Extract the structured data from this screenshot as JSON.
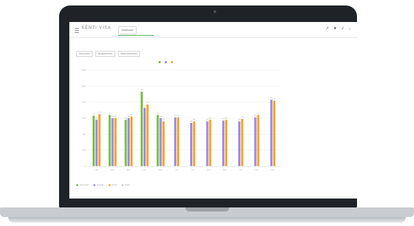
{
  "app": {
    "title": "KENTI VISA",
    "tab_label": "Dashboard",
    "header_icons": [
      "↗",
      "▼",
      "✓",
      "↓"
    ]
  },
  "filters": [
    "Time period",
    "All departments",
    "Select parameters"
  ],
  "colors": {
    "green": "#7bc043",
    "purple": "#9b8be6",
    "orange": "#f5a623"
  },
  "chart_data": {
    "type": "bar",
    "categories": [
      "Jan",
      "Feb",
      "Mar",
      "Apr",
      "May",
      "Jun",
      "Jul",
      "Aug",
      "Sep",
      "Oct",
      "Nov",
      "Dec"
    ],
    "ylim": [
      0,
      1200
    ],
    "yticks": [
      0,
      200,
      400,
      600,
      800,
      1000,
      1200
    ],
    "series": [
      {
        "name": "",
        "color": "#7bc043",
        "values": [
          630,
          640,
          580,
          930,
          640,
          null,
          null,
          null,
          null,
          null,
          null,
          null
        ]
      },
      {
        "name": "",
        "color": "#9b8be6",
        "values": [
          580,
          600,
          600,
          730,
          600,
          610,
          540,
          560,
          570,
          560,
          610,
          830
        ]
      },
      {
        "name": "",
        "color": "#f5a623",
        "values": [
          650,
          600,
          620,
          770,
          560,
          610,
          560,
          580,
          580,
          590,
          640,
          820
        ]
      }
    ],
    "legend_placement": "top-center",
    "grid": true
  },
  "footer": {
    "items": [
      {
        "color": "#7bc043",
        "label": "Last period"
      },
      {
        "color": "#9b8be6",
        "label": "Forecast"
      },
      {
        "color": "#f5a623",
        "label": "Actual"
      },
      {
        "color": "#cccccc",
        "label": "Target"
      }
    ]
  }
}
